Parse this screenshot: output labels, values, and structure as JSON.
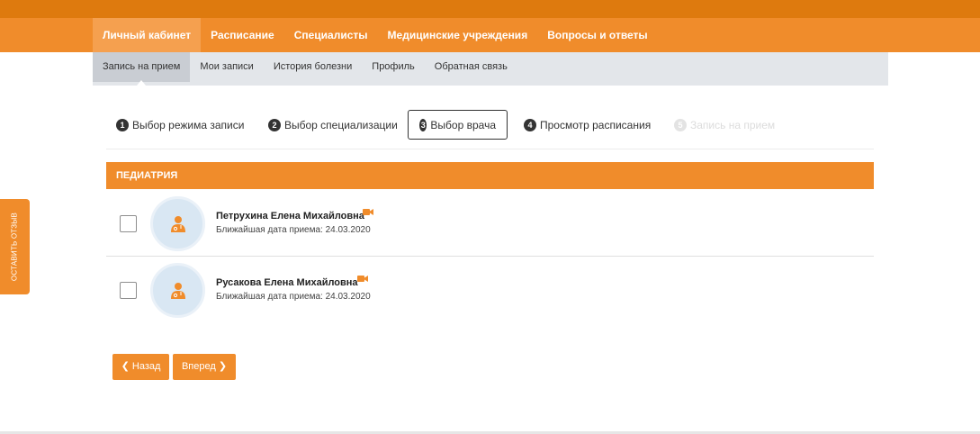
{
  "main_nav": {
    "items": [
      {
        "label": "Личный кабинет"
      },
      {
        "label": "Расписание"
      },
      {
        "label": "Специалисты"
      },
      {
        "label": "Медицинские учреждения"
      },
      {
        "label": "Вопросы и ответы"
      }
    ]
  },
  "sub_nav": {
    "items": [
      {
        "label": "Запись на прием"
      },
      {
        "label": "Мои записи"
      },
      {
        "label": "История болезни"
      },
      {
        "label": "Профиль"
      },
      {
        "label": "Обратная связь"
      }
    ]
  },
  "steps": [
    {
      "num": "1",
      "label": "Выбор режима записи"
    },
    {
      "num": "2",
      "label": "Выбор специализации"
    },
    {
      "num": "3",
      "label": "Выбор врача"
    },
    {
      "num": "4",
      "label": "Просмотр расписания"
    },
    {
      "num": "5",
      "label": "Запись на прием"
    }
  ],
  "specialty": {
    "title": "ПЕДИАТРИЯ"
  },
  "doctors": [
    {
      "name": "Петрухина Елена Михайловна",
      "next_date": "Ближайшая дата приема: 24.03.2020"
    },
    {
      "name": "Русакова Елена Михайловна",
      "next_date": "Ближайшая дата приема: 24.03.2020"
    }
  ],
  "buttons": {
    "back": "Назад",
    "next": "Вперед",
    "back_chevron": "❮",
    "next_chevron": "❯"
  },
  "feedback_tab": {
    "label": "ОСТАВИТЬ ОТЗЫВ"
  },
  "colors": {
    "accent": "#f08c2b",
    "accent_dark": "#de7a0e",
    "subnav_bg": "#e3e6ea"
  }
}
